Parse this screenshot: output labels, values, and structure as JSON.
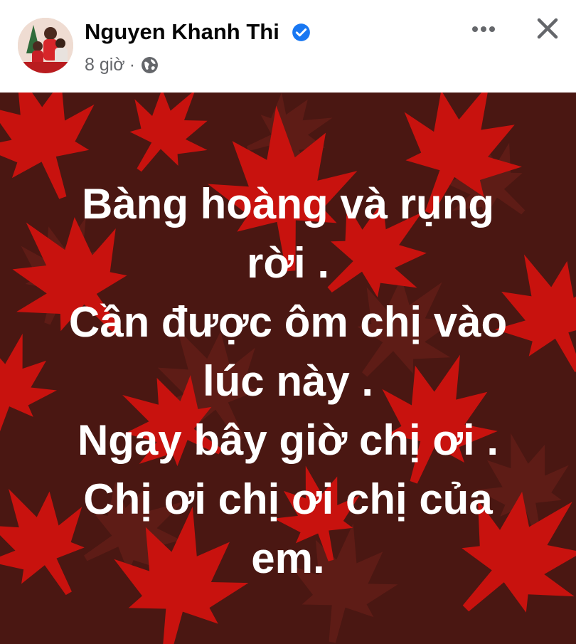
{
  "post": {
    "author": "Nguyen Khanh Thi",
    "time": "8 giờ",
    "separator": "·",
    "visibility_icon": "globe-icon",
    "verified_icon": "verified-badge-icon",
    "more_icon": "more-options-icon",
    "close_icon": "close-icon",
    "text": "Bàng hoàng và rụng\nrời .\nCần được ôm chị vào\nlúc này .\nNgay bây giờ chị ơi .\nChị ơi chị ơi chị của\nem."
  },
  "colors": {
    "background_dark": "#4a1712",
    "leaf_red": "#c8120e",
    "leaf_dim": "#5e1c16",
    "text": "#ffffff",
    "verified_blue": "#1877f2",
    "meta_gray": "#65676b"
  }
}
